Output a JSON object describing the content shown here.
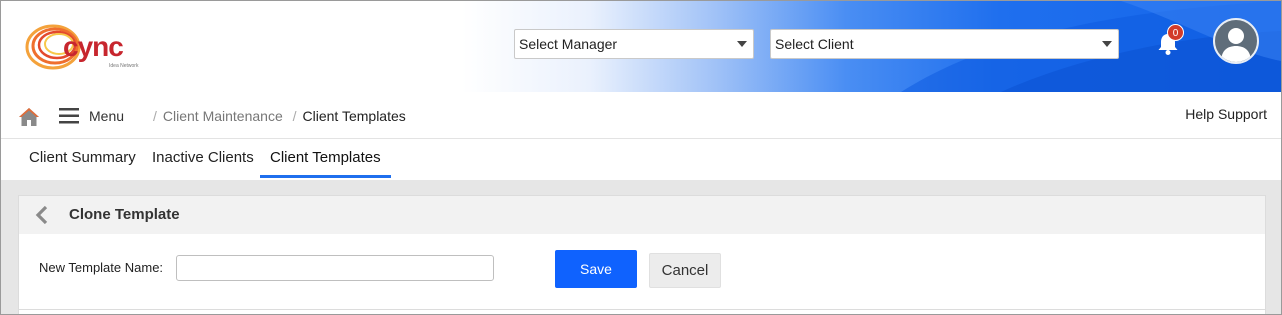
{
  "header": {
    "logo": {
      "text": "cync",
      "subtext": "Idea Network"
    },
    "manager_select": {
      "value": "Select Manager"
    },
    "client_select": {
      "value": "Select Client"
    },
    "notifications": {
      "count": "0"
    }
  },
  "navbar": {
    "menu_label": "Menu",
    "breadcrumb": [
      {
        "label": "Client Maintenance"
      },
      {
        "label": "Client Templates"
      }
    ],
    "help_label": "Help Support"
  },
  "tabs": [
    {
      "label": "Client Summary",
      "active": false
    },
    {
      "label": "Inactive Clients",
      "active": false
    },
    {
      "label": "Client Templates",
      "active": true
    }
  ],
  "panel": {
    "title": "Clone Template",
    "field_label": "New Template Name:",
    "field_value": "",
    "save_label": "Save",
    "cancel_label": "Cancel"
  },
  "colors": {
    "accent": "#1f6fee",
    "save_button": "#0f62fe",
    "badge": "#d23b2a",
    "logo": "#c7262e"
  }
}
